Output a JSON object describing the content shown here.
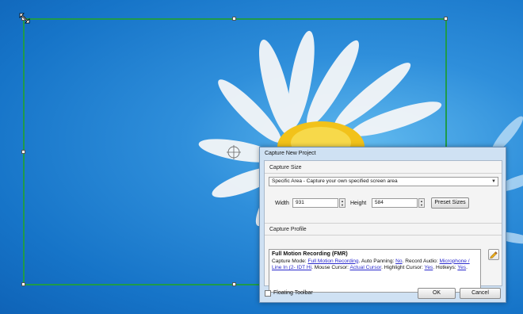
{
  "dialog": {
    "title": "Capture New Project",
    "capture_size_label": "Capture Size",
    "mode_selected": "Specific Area - Capture your own specified screen area",
    "width_label": "Width",
    "width_value": "931",
    "height_label": "Height",
    "height_value": "584",
    "preset_button": "Preset Sizes",
    "capture_profile_label": "Capture Profile",
    "profile": {
      "name": "Full Motion Recording (FMR)",
      "capture_mode_label": "Capture Mode: ",
      "capture_mode_value": "Full Motion Recording",
      "auto_panning_label": ". Auto Panning: ",
      "auto_panning_value": "No",
      "record_audio_label": ". Record Audio: ",
      "record_audio_value": "Microphone / Line In (2- IDT Hi",
      "mouse_cursor_label": ". Mouse Cursor: ",
      "mouse_cursor_value": "Actual Cursor",
      "highlight_cursor_label": ". Highlight Cursor: ",
      "highlight_cursor_value": "Yes",
      "hotkeys_label": ". Hotkeys: ",
      "hotkeys_value": "Yes",
      "end": "."
    },
    "floating_toolbar_label": "Floating Toolbar",
    "ok_button": "OK",
    "cancel_button": "Cancel"
  },
  "colors": {
    "region_border": "#1f9a4a",
    "desktop_blue": "#2f8fdb",
    "link": "#2a2acc"
  }
}
